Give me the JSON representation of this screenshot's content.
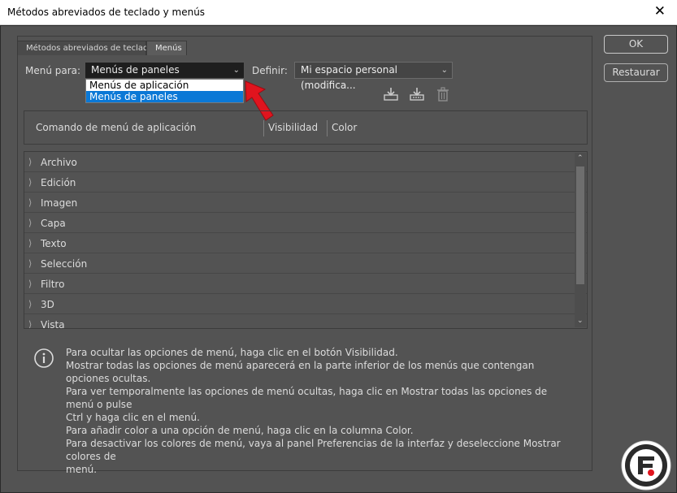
{
  "window": {
    "title": "Métodos abreviados de teclado y menús",
    "close_glyph": "✕"
  },
  "tabs": [
    "Métodos abreviados de teclado",
    "Menús"
  ],
  "menu_para": {
    "label": "Menú para:",
    "value": "Menús de paneles",
    "options": [
      "Menús de aplicación",
      "Menús de paneles"
    ]
  },
  "definir": {
    "label": "Definir:",
    "value": "Mi espacio personal (modifica..."
  },
  "toolbar_icons": [
    "save-set-icon",
    "save-as-set-icon",
    "delete-set-icon"
  ],
  "columns": [
    "Comando de menú de aplicación",
    "Visibilidad",
    "Color"
  ],
  "menu_items": [
    "Archivo",
    "Edición",
    "Imagen",
    "Capa",
    "Texto",
    "Selección",
    "Filtro",
    "3D",
    "Vista"
  ],
  "info_lines": [
    "Para ocultar las opciones de menú, haga clic en el botón Visibilidad.",
    "Mostrar todas las opciones de menú aparecerá en la parte inferior de los menús que contengan opciones ocultas.",
    "Para ver temporalmente las opciones de menú ocultas, haga clic en Mostrar todas las opciones de menú o pulse",
    "Ctrl y haga clic en el menú.",
    "Para añadir color a una opción de menú, haga clic en la columna Color.",
    "Para desactivar los colores de menú, vaya al panel Preferencias de la interfaz y deseleccione Mostrar colores de",
    "menú."
  ],
  "buttons": {
    "ok": "OK",
    "restore": "Restaurar"
  },
  "colors": {
    "background": "#535353",
    "highlight": "#0a78d6",
    "annotation_arrow": "#e0141e"
  }
}
